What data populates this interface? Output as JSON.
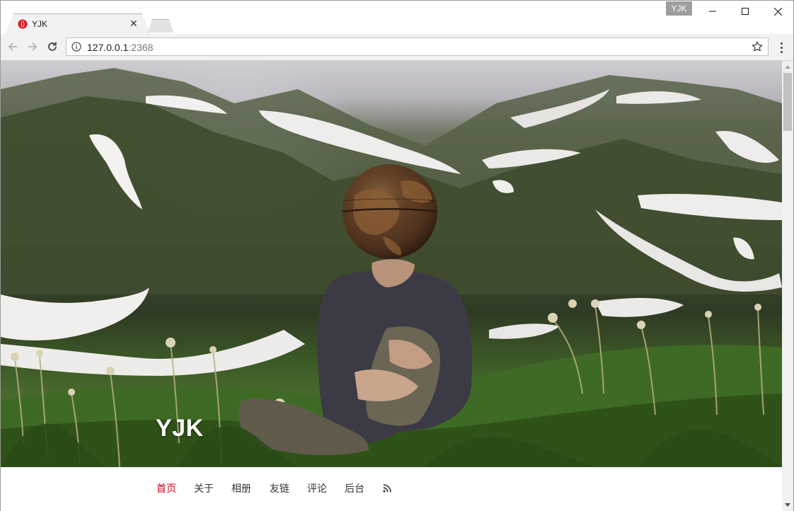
{
  "browser": {
    "tab_title": "YJK",
    "profile_badge": "YJK",
    "url_host": "127.0.0.1",
    "url_port": ":2368",
    "tab_icon": "opera-icon"
  },
  "page": {
    "blog_title": "YJK",
    "hero_image": "person with globe head sitting in grassy field before snowy mountains",
    "nav": [
      {
        "label": "首页",
        "active": true
      },
      {
        "label": "关于",
        "active": false
      },
      {
        "label": "相册",
        "active": false
      },
      {
        "label": "友链",
        "active": false
      },
      {
        "label": "评论",
        "active": false
      },
      {
        "label": "后台",
        "active": false
      }
    ],
    "nav_extra_icon": "rss-icon"
  },
  "colors": {
    "active_nav": "#d0021b",
    "nav_text": "#333333",
    "profile_badge_bg": "#9e9e9e"
  }
}
